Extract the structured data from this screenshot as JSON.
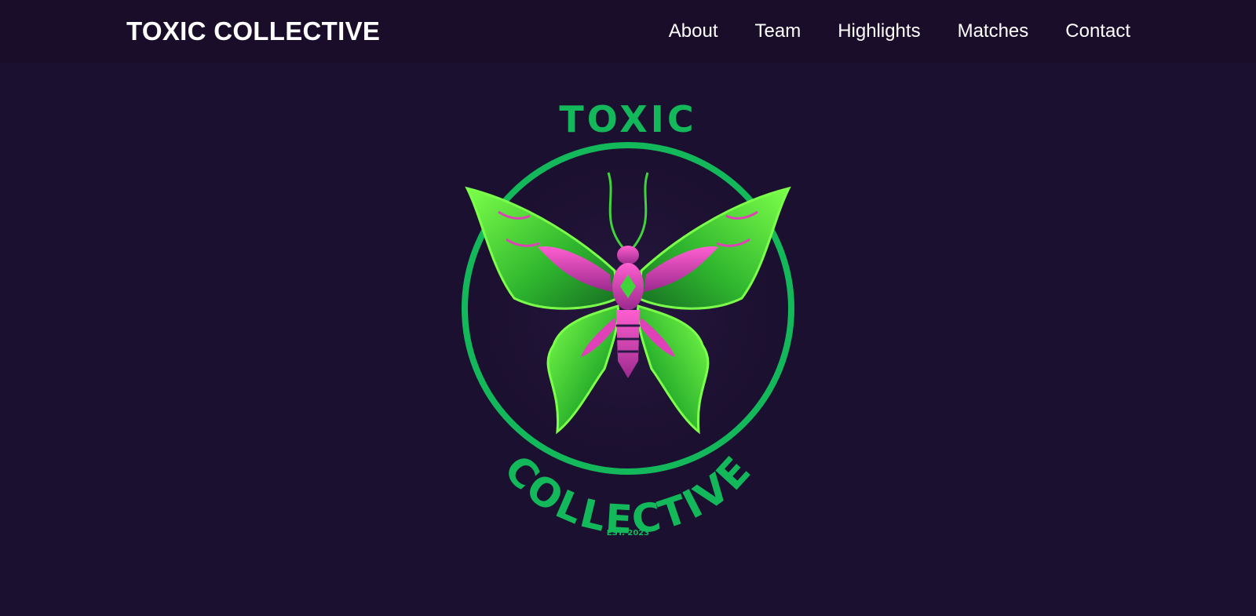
{
  "nav": {
    "brand": "TOXIC COLLECTIVE",
    "links": [
      {
        "label": "About"
      },
      {
        "label": "Team"
      },
      {
        "label": "Highlights"
      },
      {
        "label": "Matches"
      },
      {
        "label": "Contact"
      }
    ]
  },
  "hero": {
    "logo": {
      "text_top": "TOXIC",
      "text_bottom": "COLLECTIVE",
      "established": "EST. 2023",
      "icon": "butterfly-icon"
    }
  },
  "colors": {
    "page_bg": "#1c1030",
    "nav_bg": "#1a0d2a",
    "logo_green": "#12b85a",
    "wing_green": "#3fd43a",
    "wing_pink": "#e040b8"
  }
}
